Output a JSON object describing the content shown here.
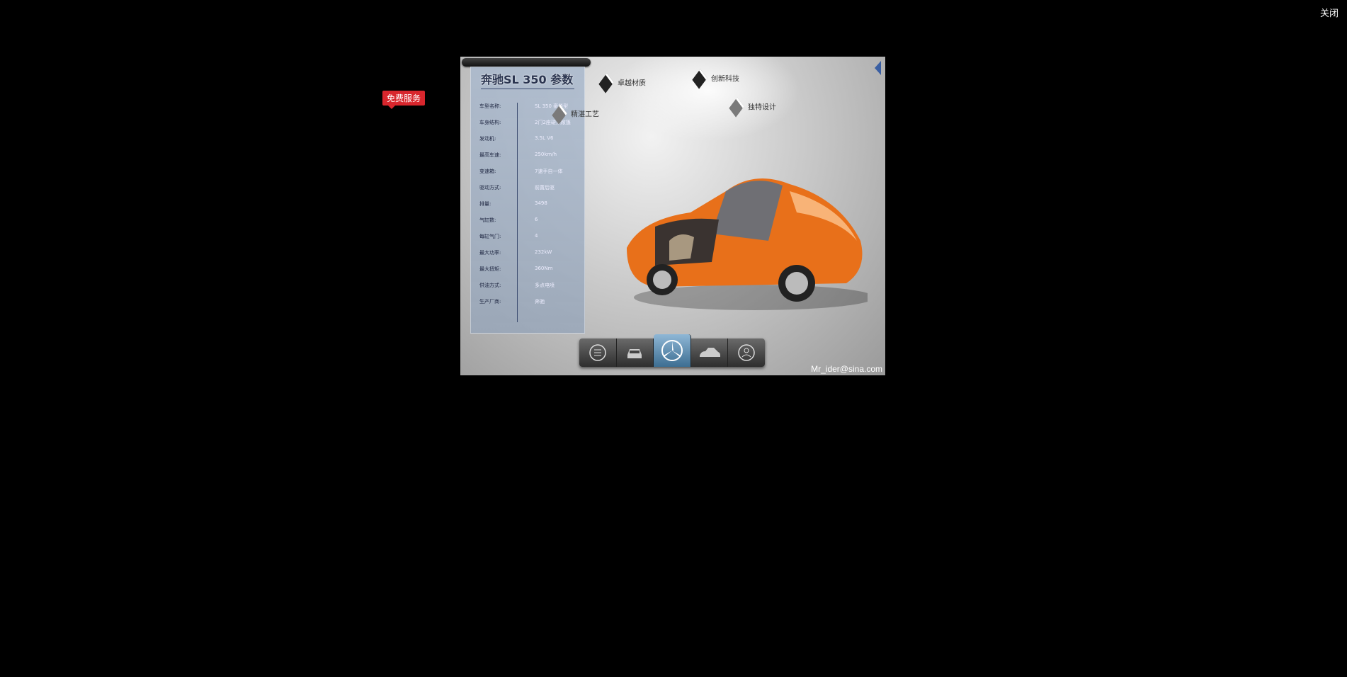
{
  "close_label": "关闭",
  "free_service_label": "免费服务",
  "spec_panel": {
    "title": "奔驰SL 350 参数",
    "rows": [
      {
        "key": "车型名称:",
        "value": "SL 350 豪华型"
      },
      {
        "key": "车身结构:",
        "value": "2门2座硬顶敞篷"
      },
      {
        "key": "发动机:",
        "value": "3.5L V6"
      },
      {
        "key": "最高车速:",
        "value": "250km/h"
      },
      {
        "key": "变速箱:",
        "value": "7速手自一体"
      },
      {
        "key": "驱动方式:",
        "value": "前置后驱"
      },
      {
        "key": "排量:",
        "value": "3498"
      },
      {
        "key": "气缸数:",
        "value": "6"
      },
      {
        "key": "每缸气门:",
        "value": "4"
      },
      {
        "key": "最大功率:",
        "value": "232kW"
      },
      {
        "key": "最大扭矩:",
        "value": "360Nm"
      },
      {
        "key": "供油方式:",
        "value": "多点电喷"
      },
      {
        "key": "生产厂商:",
        "value": "奔驰"
      }
    ]
  },
  "features": [
    {
      "label": "卓越材质"
    },
    {
      "label": "创新科技"
    },
    {
      "label": "精湛工艺"
    },
    {
      "label": "独特设计"
    }
  ],
  "toolbar": [
    {
      "icon": "list-icon"
    },
    {
      "icon": "car-front-icon"
    },
    {
      "icon": "mercedes-logo-icon"
    },
    {
      "icon": "car-side-icon"
    },
    {
      "icon": "person-icon"
    }
  ],
  "watermark": "Mr_ider@sina.com",
  "colors": {
    "car": "#e8701a",
    "badge": "#d8262d",
    "active_tool": "#3d6e92"
  }
}
